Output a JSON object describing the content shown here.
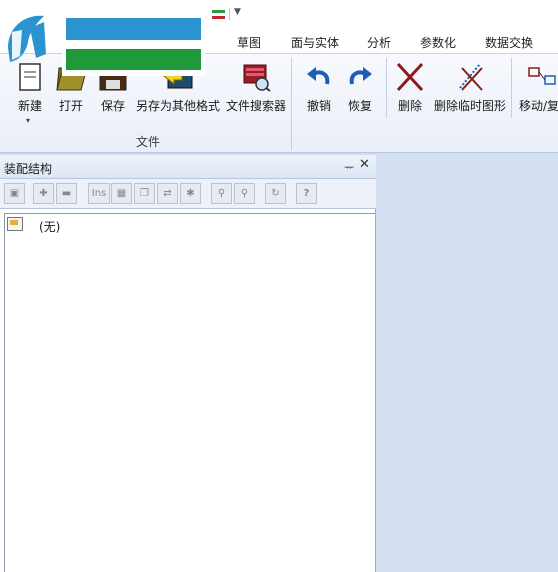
{
  "tabs": [
    "草图",
    "面与实体",
    "分析",
    "参数化",
    "数据交换"
  ],
  "ribbon": {
    "file_group": {
      "label": "文件",
      "buttons": [
        "新建",
        "打开",
        "保存",
        "另存为其他格式",
        "文件搜索器"
      ]
    },
    "edit_buttons": [
      "撤销",
      "恢复",
      "删除",
      "删除临时图形",
      "移动/复"
    ]
  },
  "panel": {
    "title": "装配结构",
    "pin_glyph": "ᅲ",
    "close_glyph": "✕",
    "toolbar_ins": "Ins",
    "toolbar_help": "?",
    "tree_item": "(无)"
  },
  "colors": {
    "accent_blue": "#2b93cf",
    "accent_green": "#1f9a3a",
    "undo_blue": "#1d5fb3",
    "delete_red": "#8b1a1a"
  }
}
